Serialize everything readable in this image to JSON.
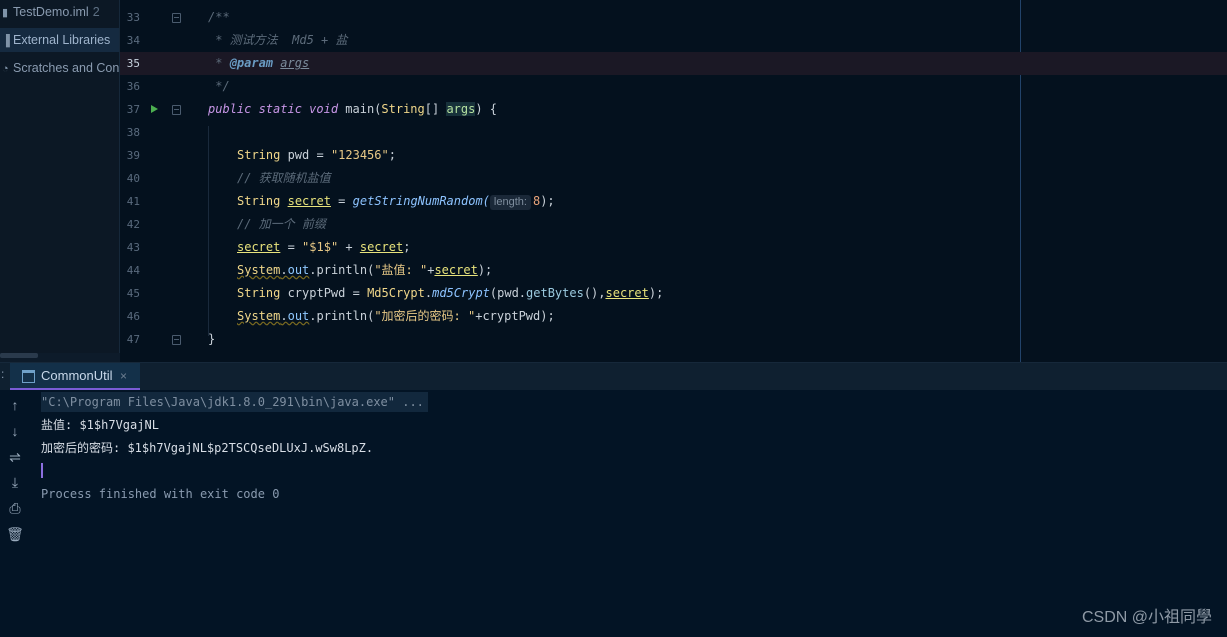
{
  "sidebar": {
    "items": [
      {
        "label": "TestDemo.iml",
        "suffix": "2",
        "icon": "file-icon"
      },
      {
        "label": "External Libraries",
        "icon": "library-icon"
      },
      {
        "label": "Scratches and Con",
        "icon": "scratches-icon"
      }
    ]
  },
  "editor": {
    "lines": [
      {
        "num": "33"
      },
      {
        "num": "34"
      },
      {
        "num": "35"
      },
      {
        "num": "36"
      },
      {
        "num": "37"
      },
      {
        "num": "38"
      },
      {
        "num": "39"
      },
      {
        "num": "40"
      },
      {
        "num": "41"
      },
      {
        "num": "42"
      },
      {
        "num": "43"
      },
      {
        "num": "44"
      },
      {
        "num": "45"
      },
      {
        "num": "46"
      },
      {
        "num": "47"
      }
    ],
    "code": {
      "l33": "/**",
      "l34": " * 测试方法  Md5 + 盐",
      "l35_star": " * ",
      "l35_tag": "@param",
      "l35_arg": "args",
      "l36": " */",
      "l37_kw": "public static void",
      "l37_name": " main(",
      "l37_type": "String",
      "l37_arr": "[] ",
      "l37_param": "args",
      "l37_end": ") {",
      "l39_type": "String",
      "l39_var": " pwd = ",
      "l39_str": "\"123456\"",
      "l39_end": ";",
      "l40": "// 获取随机盐值",
      "l41_type": "String",
      "l41_var": "secret",
      "l41_eq": " = ",
      "l41_call": "getStringNumRandom(",
      "l41_hint": "length:",
      "l41_num": "8",
      "l41_end": ");",
      "l42": "// 加一个 前缀",
      "l43_var": "secret",
      "l43_eq": " = ",
      "l43_str": "\"$1$\"",
      "l43_plus": " + ",
      "l43_var2": "secret",
      "l43_end": ";",
      "l44_cls": "System",
      "l44_dot": ".",
      "l44_out": "out",
      "l44_call": ".println(",
      "l44_str": "\"盐值: \"",
      "l44_plus": "+",
      "l44_var": "secret",
      "l44_end": ");",
      "l45_type": "String",
      "l45_var": " cryptPwd = ",
      "l45_cls": "Md5Crypt",
      "l45_dot": ".",
      "l45_call": "md5Crypt",
      "l45_args": "(pwd.",
      "l45_m": "getBytes",
      "l45_args2": "(),",
      "l45_var2": "secret",
      "l45_end": ");",
      "l46_cls": "System",
      "l46_dot": ".",
      "l46_out": "out",
      "l46_call": ".println(",
      "l46_str": "\"加密后的密码: \"",
      "l46_plus": "+cryptPwd);",
      "l47": "}"
    }
  },
  "run": {
    "tab_label": "CommonUtil",
    "close": "×",
    "toolbar": [
      "up-arrow-icon",
      "down-arrow-icon",
      "soft-wrap-icon",
      "scroll-to-end-icon",
      "print-icon",
      "trash-icon"
    ],
    "output": {
      "cmd": "\"C:\\Program Files\\Java\\jdk1.8.0_291\\bin\\java.exe\" ...",
      "line1": "盐值: $1$h7VgajNL",
      "line2": "加密后的密码: $1$h7VgajNL$p2TSCQseDLUxJ.wSw8LpZ.",
      "exit": "Process finished with exit code 0"
    }
  },
  "watermark": "CSDN @小祖同學"
}
